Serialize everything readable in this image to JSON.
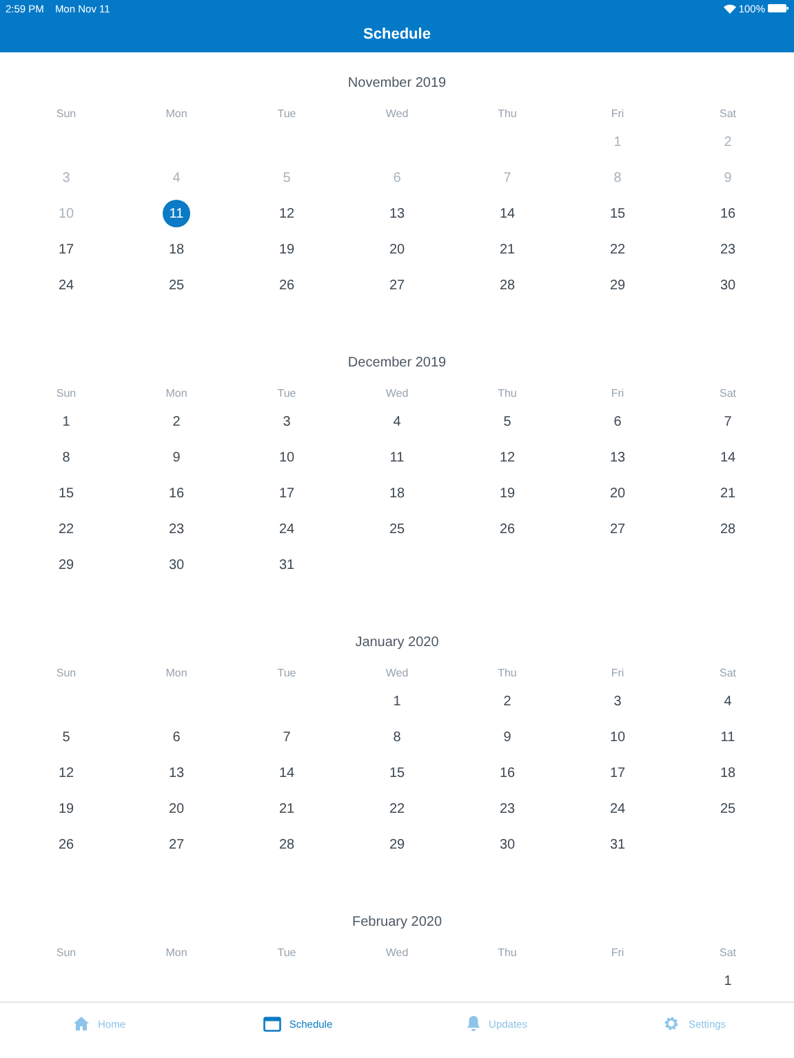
{
  "status_bar": {
    "time": "2:59 PM",
    "date": "Mon Nov 11",
    "battery": "100%"
  },
  "nav_bar": {
    "title": "Schedule"
  },
  "months": [
    {
      "title": "November 2019",
      "weekdays": [
        "Sun",
        "Mon",
        "Tue",
        "Wed",
        "Thu",
        "Fri",
        "Sat"
      ],
      "weeks": [
        [
          {
            "kind": "empty"
          },
          {
            "kind": "empty"
          },
          {
            "kind": "empty"
          },
          {
            "kind": "empty"
          },
          {
            "kind": "empty"
          },
          {
            "kind": "day",
            "day": "1",
            "past": true,
            "selected": false
          },
          {
            "kind": "day",
            "day": "2",
            "past": true,
            "selected": false
          }
        ],
        [
          {
            "kind": "day",
            "day": "3",
            "past": true,
            "selected": false
          },
          {
            "kind": "day",
            "day": "4",
            "past": true,
            "selected": false
          },
          {
            "kind": "day",
            "day": "5",
            "past": true,
            "selected": false
          },
          {
            "kind": "day",
            "day": "6",
            "past": true,
            "selected": false
          },
          {
            "kind": "day",
            "day": "7",
            "past": true,
            "selected": false
          },
          {
            "kind": "day",
            "day": "8",
            "past": true,
            "selected": false
          },
          {
            "kind": "day",
            "day": "9",
            "past": true,
            "selected": false
          }
        ],
        [
          {
            "kind": "day",
            "day": "10",
            "past": true,
            "selected": false
          },
          {
            "kind": "day",
            "day": "11",
            "past": false,
            "selected": true
          },
          {
            "kind": "day",
            "day": "12",
            "past": false,
            "selected": false
          },
          {
            "kind": "day",
            "day": "13",
            "past": false,
            "selected": false
          },
          {
            "kind": "day",
            "day": "14",
            "past": false,
            "selected": false
          },
          {
            "kind": "day",
            "day": "15",
            "past": false,
            "selected": false
          },
          {
            "kind": "day",
            "day": "16",
            "past": false,
            "selected": false
          }
        ],
        [
          {
            "kind": "day",
            "day": "17",
            "past": false,
            "selected": false
          },
          {
            "kind": "day",
            "day": "18",
            "past": false,
            "selected": false
          },
          {
            "kind": "day",
            "day": "19",
            "past": false,
            "selected": false
          },
          {
            "kind": "day",
            "day": "20",
            "past": false,
            "selected": false
          },
          {
            "kind": "day",
            "day": "21",
            "past": false,
            "selected": false
          },
          {
            "kind": "day",
            "day": "22",
            "past": false,
            "selected": false
          },
          {
            "kind": "day",
            "day": "23",
            "past": false,
            "selected": false
          }
        ],
        [
          {
            "kind": "day",
            "day": "24",
            "past": false,
            "selected": false
          },
          {
            "kind": "day",
            "day": "25",
            "past": false,
            "selected": false
          },
          {
            "kind": "day",
            "day": "26",
            "past": false,
            "selected": false
          },
          {
            "kind": "day",
            "day": "27",
            "past": false,
            "selected": false
          },
          {
            "kind": "day",
            "day": "28",
            "past": false,
            "selected": false
          },
          {
            "kind": "day",
            "day": "29",
            "past": false,
            "selected": false
          },
          {
            "kind": "day",
            "day": "30",
            "past": false,
            "selected": false
          }
        ]
      ]
    },
    {
      "title": "December 2019",
      "weekdays": [
        "Sun",
        "Mon",
        "Tue",
        "Wed",
        "Thu",
        "Fri",
        "Sat"
      ],
      "weeks": [
        [
          {
            "kind": "day",
            "day": "1",
            "past": false,
            "selected": false
          },
          {
            "kind": "day",
            "day": "2",
            "past": false,
            "selected": false
          },
          {
            "kind": "day",
            "day": "3",
            "past": false,
            "selected": false
          },
          {
            "kind": "day",
            "day": "4",
            "past": false,
            "selected": false
          },
          {
            "kind": "day",
            "day": "5",
            "past": false,
            "selected": false
          },
          {
            "kind": "day",
            "day": "6",
            "past": false,
            "selected": false
          },
          {
            "kind": "day",
            "day": "7",
            "past": false,
            "selected": false
          }
        ],
        [
          {
            "kind": "day",
            "day": "8",
            "past": false,
            "selected": false
          },
          {
            "kind": "day",
            "day": "9",
            "past": false,
            "selected": false
          },
          {
            "kind": "day",
            "day": "10",
            "past": false,
            "selected": false
          },
          {
            "kind": "day",
            "day": "11",
            "past": false,
            "selected": false
          },
          {
            "kind": "day",
            "day": "12",
            "past": false,
            "selected": false
          },
          {
            "kind": "day",
            "day": "13",
            "past": false,
            "selected": false
          },
          {
            "kind": "day",
            "day": "14",
            "past": false,
            "selected": false
          }
        ],
        [
          {
            "kind": "day",
            "day": "15",
            "past": false,
            "selected": false
          },
          {
            "kind": "day",
            "day": "16",
            "past": false,
            "selected": false
          },
          {
            "kind": "day",
            "day": "17",
            "past": false,
            "selected": false
          },
          {
            "kind": "day",
            "day": "18",
            "past": false,
            "selected": false
          },
          {
            "kind": "day",
            "day": "19",
            "past": false,
            "selected": false
          },
          {
            "kind": "day",
            "day": "20",
            "past": false,
            "selected": false
          },
          {
            "kind": "day",
            "day": "21",
            "past": false,
            "selected": false
          }
        ],
        [
          {
            "kind": "day",
            "day": "22",
            "past": false,
            "selected": false
          },
          {
            "kind": "day",
            "day": "23",
            "past": false,
            "selected": false
          },
          {
            "kind": "day",
            "day": "24",
            "past": false,
            "selected": false
          },
          {
            "kind": "day",
            "day": "25",
            "past": false,
            "selected": false
          },
          {
            "kind": "day",
            "day": "26",
            "past": false,
            "selected": false
          },
          {
            "kind": "day",
            "day": "27",
            "past": false,
            "selected": false
          },
          {
            "kind": "day",
            "day": "28",
            "past": false,
            "selected": false
          }
        ],
        [
          {
            "kind": "day",
            "day": "29",
            "past": false,
            "selected": false
          },
          {
            "kind": "day",
            "day": "30",
            "past": false,
            "selected": false
          },
          {
            "kind": "day",
            "day": "31",
            "past": false,
            "selected": false
          },
          {
            "kind": "empty"
          },
          {
            "kind": "empty"
          },
          {
            "kind": "empty"
          },
          {
            "kind": "empty"
          }
        ]
      ]
    },
    {
      "title": "January 2020",
      "weekdays": [
        "Sun",
        "Mon",
        "Tue",
        "Wed",
        "Thu",
        "Fri",
        "Sat"
      ],
      "weeks": [
        [
          {
            "kind": "empty"
          },
          {
            "kind": "empty"
          },
          {
            "kind": "empty"
          },
          {
            "kind": "day",
            "day": "1",
            "past": false,
            "selected": false
          },
          {
            "kind": "day",
            "day": "2",
            "past": false,
            "selected": false
          },
          {
            "kind": "day",
            "day": "3",
            "past": false,
            "selected": false
          },
          {
            "kind": "day",
            "day": "4",
            "past": false,
            "selected": false
          }
        ],
        [
          {
            "kind": "day",
            "day": "5",
            "past": false,
            "selected": false
          },
          {
            "kind": "day",
            "day": "6",
            "past": false,
            "selected": false
          },
          {
            "kind": "day",
            "day": "7",
            "past": false,
            "selected": false
          },
          {
            "kind": "day",
            "day": "8",
            "past": false,
            "selected": false
          },
          {
            "kind": "day",
            "day": "9",
            "past": false,
            "selected": false
          },
          {
            "kind": "day",
            "day": "10",
            "past": false,
            "selected": false
          },
          {
            "kind": "day",
            "day": "11",
            "past": false,
            "selected": false
          }
        ],
        [
          {
            "kind": "day",
            "day": "12",
            "past": false,
            "selected": false
          },
          {
            "kind": "day",
            "day": "13",
            "past": false,
            "selected": false
          },
          {
            "kind": "day",
            "day": "14",
            "past": false,
            "selected": false
          },
          {
            "kind": "day",
            "day": "15",
            "past": false,
            "selected": false
          },
          {
            "kind": "day",
            "day": "16",
            "past": false,
            "selected": false
          },
          {
            "kind": "day",
            "day": "17",
            "past": false,
            "selected": false
          },
          {
            "kind": "day",
            "day": "18",
            "past": false,
            "selected": false
          }
        ],
        [
          {
            "kind": "day",
            "day": "19",
            "past": false,
            "selected": false
          },
          {
            "kind": "day",
            "day": "20",
            "past": false,
            "selected": false
          },
          {
            "kind": "day",
            "day": "21",
            "past": false,
            "selected": false
          },
          {
            "kind": "day",
            "day": "22",
            "past": false,
            "selected": false
          },
          {
            "kind": "day",
            "day": "23",
            "past": false,
            "selected": false
          },
          {
            "kind": "day",
            "day": "24",
            "past": false,
            "selected": false
          },
          {
            "kind": "day",
            "day": "25",
            "past": false,
            "selected": false
          }
        ],
        [
          {
            "kind": "day",
            "day": "26",
            "past": false,
            "selected": false
          },
          {
            "kind": "day",
            "day": "27",
            "past": false,
            "selected": false
          },
          {
            "kind": "day",
            "day": "28",
            "past": false,
            "selected": false
          },
          {
            "kind": "day",
            "day": "29",
            "past": false,
            "selected": false
          },
          {
            "kind": "day",
            "day": "30",
            "past": false,
            "selected": false
          },
          {
            "kind": "day",
            "day": "31",
            "past": false,
            "selected": false
          },
          {
            "kind": "empty"
          }
        ]
      ]
    },
    {
      "title": "February 2020",
      "weekdays": [
        "Sun",
        "Mon",
        "Tue",
        "Wed",
        "Thu",
        "Fri",
        "Sat"
      ],
      "weeks": [
        [
          {
            "kind": "empty"
          },
          {
            "kind": "empty"
          },
          {
            "kind": "empty"
          },
          {
            "kind": "empty"
          },
          {
            "kind": "empty"
          },
          {
            "kind": "empty"
          },
          {
            "kind": "day",
            "day": "1",
            "past": false,
            "selected": false
          }
        ]
      ]
    }
  ],
  "tab_bar": [
    {
      "kind": "home",
      "label": "Home",
      "selected": false
    },
    {
      "kind": "schedule",
      "label": "Schedule",
      "selected": true
    },
    {
      "kind": "updates",
      "label": "Updates",
      "selected": false
    },
    {
      "kind": "settings",
      "label": "Settings",
      "selected": false
    }
  ]
}
